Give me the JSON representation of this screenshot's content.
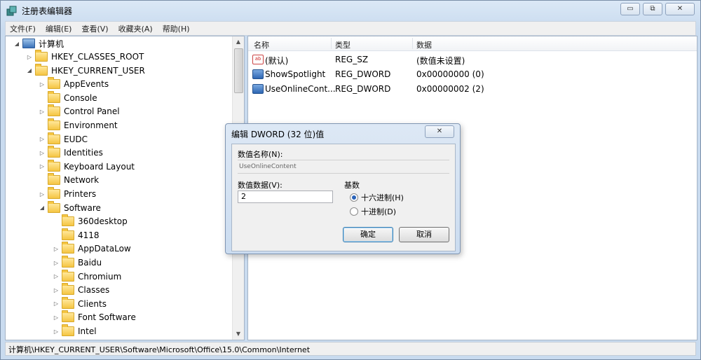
{
  "window": {
    "title": "注册表编辑器",
    "buttons": {
      "minimize": "▭",
      "restore": "⧉",
      "close": "✕"
    }
  },
  "menu": [
    "文件(F)",
    "编辑(E)",
    "查看(V)",
    "收藏夹(A)",
    "帮助(H)"
  ],
  "tree": {
    "root": "计算机",
    "items": [
      {
        "label": "HKEY_CLASSES_ROOT",
        "level": 1,
        "expander": "▷"
      },
      {
        "label": "HKEY_CURRENT_USER",
        "level": 1,
        "expander": "◢"
      },
      {
        "label": "AppEvents",
        "level": 2,
        "expander": "▷"
      },
      {
        "label": "Console",
        "level": 2,
        "expander": ""
      },
      {
        "label": "Control Panel",
        "level": 2,
        "expander": "▷"
      },
      {
        "label": "Environment",
        "level": 2,
        "expander": ""
      },
      {
        "label": "EUDC",
        "level": 2,
        "expander": "▷"
      },
      {
        "label": "Identities",
        "level": 2,
        "expander": "▷"
      },
      {
        "label": "Keyboard Layout",
        "level": 2,
        "expander": "▷"
      },
      {
        "label": "Network",
        "level": 2,
        "expander": ""
      },
      {
        "label": "Printers",
        "level": 2,
        "expander": "▷"
      },
      {
        "label": "Software",
        "level": 2,
        "expander": "◢"
      },
      {
        "label": "360desktop",
        "level": 3,
        "expander": ""
      },
      {
        "label": "4118",
        "level": 3,
        "expander": ""
      },
      {
        "label": "AppDataLow",
        "level": 3,
        "expander": "▷"
      },
      {
        "label": "Baidu",
        "level": 3,
        "expander": "▷"
      },
      {
        "label": "Chromium",
        "level": 3,
        "expander": "▷"
      },
      {
        "label": "Classes",
        "level": 3,
        "expander": "▷"
      },
      {
        "label": "Clients",
        "level": 3,
        "expander": "▷"
      },
      {
        "label": "Font Software",
        "level": 3,
        "expander": "▷"
      },
      {
        "label": "Intel",
        "level": 3,
        "expander": "▷"
      }
    ]
  },
  "list": {
    "headers": {
      "name": "名称",
      "type": "类型",
      "data": "数据"
    },
    "rows": [
      {
        "name": "(默认)",
        "type": "REG_SZ",
        "data": "(数值未设置)",
        "icon": "string-value-icon"
      },
      {
        "name": "ShowSpotlight",
        "type": "REG_DWORD",
        "data": "0x00000000 (0)",
        "icon": "dword-value-icon"
      },
      {
        "name": "UseOnlineCont...",
        "type": "REG_DWORD",
        "data": "0x00000002 (2)",
        "icon": "dword-value-icon"
      }
    ]
  },
  "status": "计算机\\HKEY_CURRENT_USER\\Software\\Microsoft\\Office\\15.0\\Common\\Internet",
  "dialog": {
    "title": "编辑 DWORD (32 位)值",
    "close": "✕",
    "name_label": "数值名称(N):",
    "name_value": "UseOnlineContent",
    "data_label": "数值数据(V):",
    "data_value": "2",
    "base_label": "基数",
    "hex_label": "十六进制(H)",
    "dec_label": "十进制(D)",
    "ok": "确定",
    "cancel": "取消"
  }
}
